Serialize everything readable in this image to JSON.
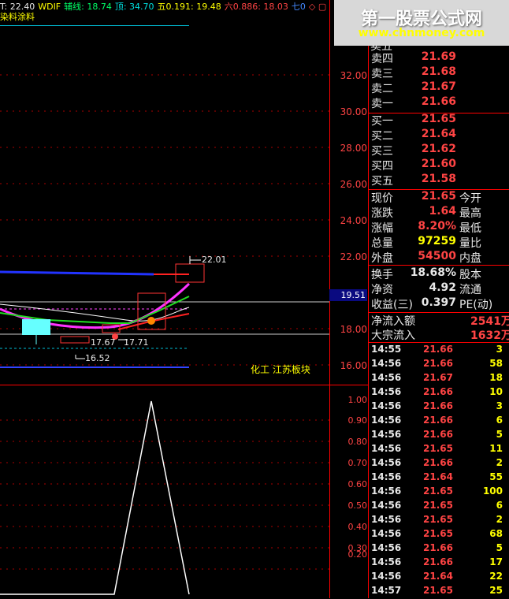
{
  "topbar": {
    "t_label": "T: 22.40",
    "wdif_label": "WDIF",
    "fuxian_label": "辅线: 18.74",
    "ding_label": "顶: 34.70",
    "wu_label": "五0.191: 19.48",
    "liu_label": "六0.886: 18.03",
    "qi_label": "七0",
    "indicator_name": "染料涂料"
  },
  "watermark": {
    "title": "第一股票公式网",
    "url": "www.chnmoney.com"
  },
  "price_axis": [
    "32.00",
    "30.00",
    "28.00",
    "26.00",
    "24.00",
    "22.00",
    "18.00",
    "16.00"
  ],
  "current_price_tag": "19.51",
  "chart_labels": {
    "high_label": "22.01",
    "low_label": "16.52",
    "mid_label_1": "17.67",
    "mid_label_2": "17.71",
    "sector_label": "化工 江苏板块"
  },
  "indicator_axis": [
    "1.00",
    "0.90",
    "0.80",
    "0.70",
    "0.60",
    "0.50",
    "0.40",
    "0.30",
    "0.20"
  ],
  "order_book": {
    "asks": [
      {
        "label": "卖四",
        "price": "21.69"
      },
      {
        "label": "卖三",
        "price": "21.68"
      },
      {
        "label": "卖二",
        "price": "21.67"
      },
      {
        "label": "卖一",
        "price": "21.66"
      }
    ],
    "bids": [
      {
        "label": "买一",
        "price": "21.65"
      },
      {
        "label": "买二",
        "price": "21.64"
      },
      {
        "label": "买三",
        "price": "21.62"
      },
      {
        "label": "买四",
        "price": "21.60"
      },
      {
        "label": "买五",
        "price": "21.58"
      }
    ]
  },
  "quote_stats": [
    {
      "label": "现价",
      "value": "21.65",
      "label2": "今开"
    },
    {
      "label": "涨跌",
      "value": "1.64",
      "label2": "最高"
    },
    {
      "label": "涨幅",
      "value": "8.20%",
      "label2": "最低"
    },
    {
      "label": "总量",
      "value": "97259",
      "label2": "量比"
    },
    {
      "label": "外盘",
      "value": "54500",
      "label2": "内盘"
    }
  ],
  "quote_stats2": [
    {
      "label": "换手",
      "value": "18.68%",
      "label2": "股本"
    },
    {
      "label": "净资",
      "value": "4.92",
      "label2": "流通"
    },
    {
      "label": "收益(三)",
      "value": "0.397",
      "label2": "PE(动)"
    }
  ],
  "fund_flow": [
    {
      "label": "净流入额",
      "value": "2541万"
    },
    {
      "label": "大宗流入",
      "value": "1632万"
    }
  ],
  "ticks": [
    {
      "time": "14:55",
      "price": "21.66",
      "vol": "3"
    },
    {
      "time": "14:56",
      "price": "21.66",
      "vol": "58"
    },
    {
      "time": "14:56",
      "price": "21.67",
      "vol": "18"
    },
    {
      "time": "14:56",
      "price": "21.66",
      "vol": "10"
    },
    {
      "time": "14:56",
      "price": "21.66",
      "vol": "3"
    },
    {
      "time": "14:56",
      "price": "21.66",
      "vol": "6"
    },
    {
      "time": "14:56",
      "price": "21.66",
      "vol": "5"
    },
    {
      "time": "14:56",
      "price": "21.65",
      "vol": "11"
    },
    {
      "time": "14:56",
      "price": "21.66",
      "vol": "2"
    },
    {
      "time": "14:56",
      "price": "21.64",
      "vol": "55"
    },
    {
      "time": "14:56",
      "price": "21.65",
      "vol": "100"
    },
    {
      "time": "14:56",
      "price": "21.65",
      "vol": "6"
    },
    {
      "time": "14:56",
      "price": "21.65",
      "vol": "2"
    },
    {
      "time": "14:56",
      "price": "21.65",
      "vol": "68"
    },
    {
      "time": "14:56",
      "price": "21.66",
      "vol": "5"
    },
    {
      "time": "14:56",
      "price": "21.66",
      "vol": "17"
    },
    {
      "time": "14:56",
      "price": "21.64",
      "vol": "22"
    },
    {
      "time": "14:57",
      "price": "21.65",
      "vol": "25"
    }
  ]
}
